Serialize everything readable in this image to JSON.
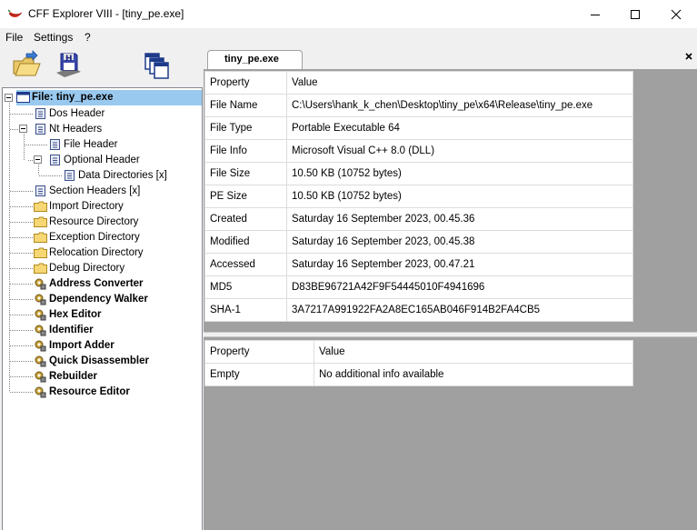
{
  "window": {
    "title": "CFF Explorer VIII - [tiny_pe.exe]",
    "icons": {
      "app": "red-pepper-icon",
      "minimize": "minimize-icon",
      "maximize": "maximize-icon",
      "close": "close-icon"
    }
  },
  "menu": {
    "items": [
      "File",
      "Settings",
      "?"
    ]
  },
  "toolbar": {
    "buttons": [
      "open-folder-icon",
      "save-disk-icon",
      "windows-icon"
    ]
  },
  "tree": {
    "root": "File: tiny_pe.exe",
    "nodes": [
      "Dos Header",
      "Nt Headers",
      "File Header",
      "Optional Header",
      "Data Directories [x]",
      "Section Headers [x]",
      "Import Directory",
      "Resource Directory",
      "Exception Directory",
      "Relocation Directory",
      "Debug Directory",
      "Address Converter",
      "Dependency Walker",
      "Hex Editor",
      "Identifier",
      "Import Adder",
      "Quick Disassembler",
      "Rebuilder",
      "Resource Editor"
    ]
  },
  "tab": {
    "label": "tiny_pe.exe",
    "close": "×"
  },
  "properties": {
    "headers": [
      "Property",
      "Value"
    ],
    "rows": [
      [
        "File Name",
        "C:\\Users\\hank_k_chen\\Desktop\\tiny_pe\\x64\\Release\\tiny_pe.exe"
      ],
      [
        "File Type",
        "Portable Executable 64"
      ],
      [
        "File Info",
        "Microsoft Visual C++ 8.0 (DLL)"
      ],
      [
        "File Size",
        "10.50 KB (10752 bytes)"
      ],
      [
        "PE Size",
        "10.50 KB (10752 bytes)"
      ],
      [
        "Created",
        "Saturday 16 September 2023, 00.45.36"
      ],
      [
        "Modified",
        "Saturday 16 September 2023, 00.45.38"
      ],
      [
        "Accessed",
        "Saturday 16 September 2023, 00.47.21"
      ],
      [
        "MD5",
        "D83BE96721A42F9F54445010F4941696"
      ],
      [
        "SHA-1",
        "3A7217A991922FA2A8EC165AB046F914B2FA4CB5"
      ]
    ]
  },
  "extra_info": {
    "headers": [
      "Property",
      "Value"
    ],
    "rows": [
      [
        "Empty",
        "No additional info available"
      ]
    ]
  }
}
